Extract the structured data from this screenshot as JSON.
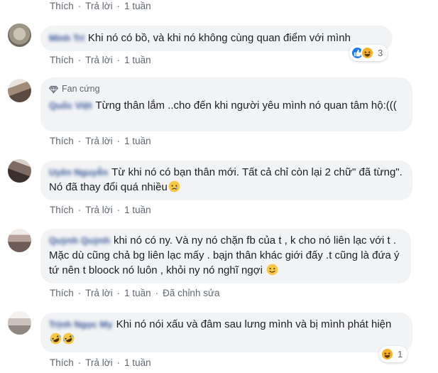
{
  "labels": {
    "like": "Thích",
    "reply": "Trả lời",
    "edited": "Đã chỉnh sửa"
  },
  "top": {
    "time": "1 tuần"
  },
  "comments": [
    {
      "author": "Minh Trí",
      "text": "Khi nó có bồ, và khi nó không cùng quan điểm với mình",
      "time": "1 tuần",
      "reactions": {
        "icons": [
          "like-reaction",
          "haha-reaction"
        ],
        "count": "3"
      }
    },
    {
      "badge": "Fan cứng",
      "author": "Quốc Việt",
      "text": "Từng thân lắm ..cho đến khi người yêu mình nó quan tâm hộ:(((",
      "time": "1 tuần"
    },
    {
      "author": "Uyên Nguyễn",
      "text": "Từ khi nó có bạn thân mới. Tất cả chỉ còn lại 2 chữ\" đã từng\". Nó đã thay đổi quá nhiều",
      "emoji": "sad-face-emoji",
      "time": "1 tuần"
    },
    {
      "author": "Quỳnh Quỳnh",
      "text": "khi nó có ny. Và ny nó chặn fb của t , k cho nó liên lạc với t . Mặc dù cũng chả bg liên lạc mấy . bạjn thân khác giới đấy .t cũng là đứa ý tứ nên t bloock nó luôn , khỏi ny nó nghĩ ngợi",
      "emoji": "smile-emoji",
      "time": "1 tuần",
      "edited": true
    },
    {
      "author": "Trịnh Ngọc My",
      "text": "Khi nó nói xấu và đâm sau lưng mình và bị mình phát hiện",
      "emoji": "rofl-emoji",
      "time": "1 tuần",
      "reactions": {
        "icons": [
          "haha-reaction"
        ],
        "count": "1"
      }
    }
  ],
  "colors": {
    "bubble": "#f2f3f5",
    "name": "#385898",
    "meta": "#606770",
    "like": "#1877f2",
    "haha": "#f7b125"
  }
}
